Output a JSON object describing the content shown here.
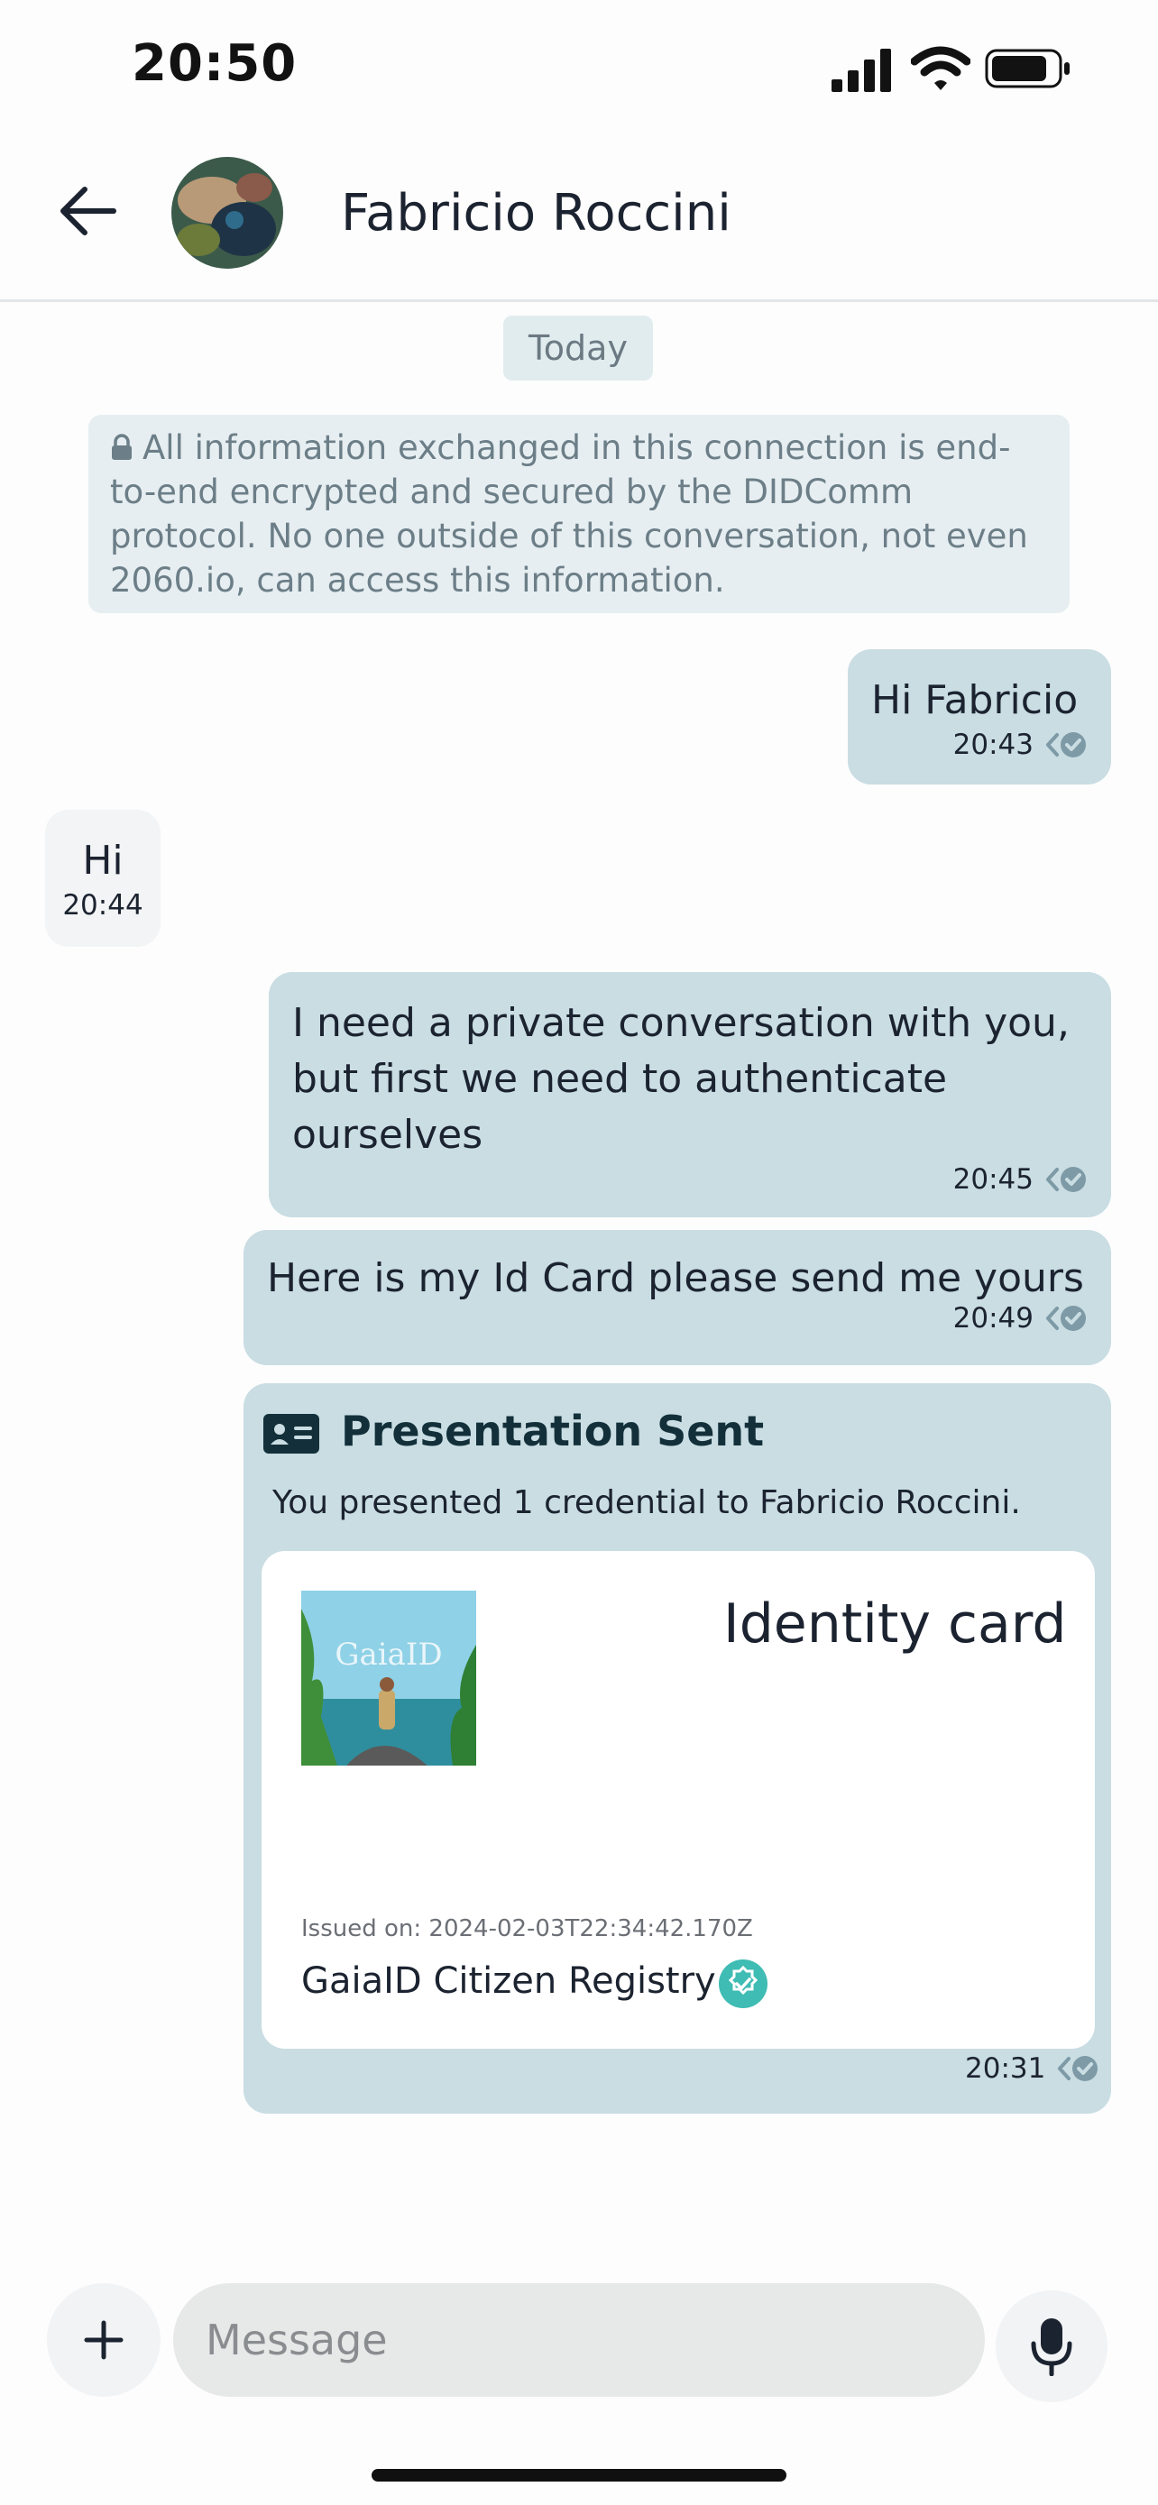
{
  "status_bar": {
    "time": "20:50"
  },
  "header": {
    "contact_name": "Fabricio Roccini"
  },
  "conversation": {
    "date_chip": "Today",
    "encryption_notice": "All information exchanged in this connection is end-to-end encrypted and secured by the DIDComm protocol. No one outside of this conversation, not even 2060.io, can access this information.",
    "messages": [
      {
        "direction": "out",
        "text": "Hi Fabricio",
        "time": "20:43"
      },
      {
        "direction": "in",
        "text": "Hi",
        "time": "20:44"
      },
      {
        "direction": "out",
        "text": "I need a private conversation with you, but first we need to authenticate ourselves",
        "time": "20:45"
      },
      {
        "direction": "out",
        "text": "Here is my Id Card please send me yours",
        "time": "20:49"
      }
    ],
    "presentation": {
      "title": "Presentation Sent",
      "subtitle": "You presented 1 credential to Fabricio Roccini.",
      "card_title": "Identity card",
      "card_image_text": "GaiaID",
      "issued_on": "Issued on: 2024-02-03T22:34:42.170Z",
      "issuer": "GaiaID Citizen Registry",
      "time": "20:31"
    }
  },
  "composer": {
    "placeholder": "Message"
  },
  "colors": {
    "outgoing_bubble": "#c9dde3",
    "incoming_bubble": "#f2f4f6",
    "verified_badge": "#3fbcb3"
  }
}
